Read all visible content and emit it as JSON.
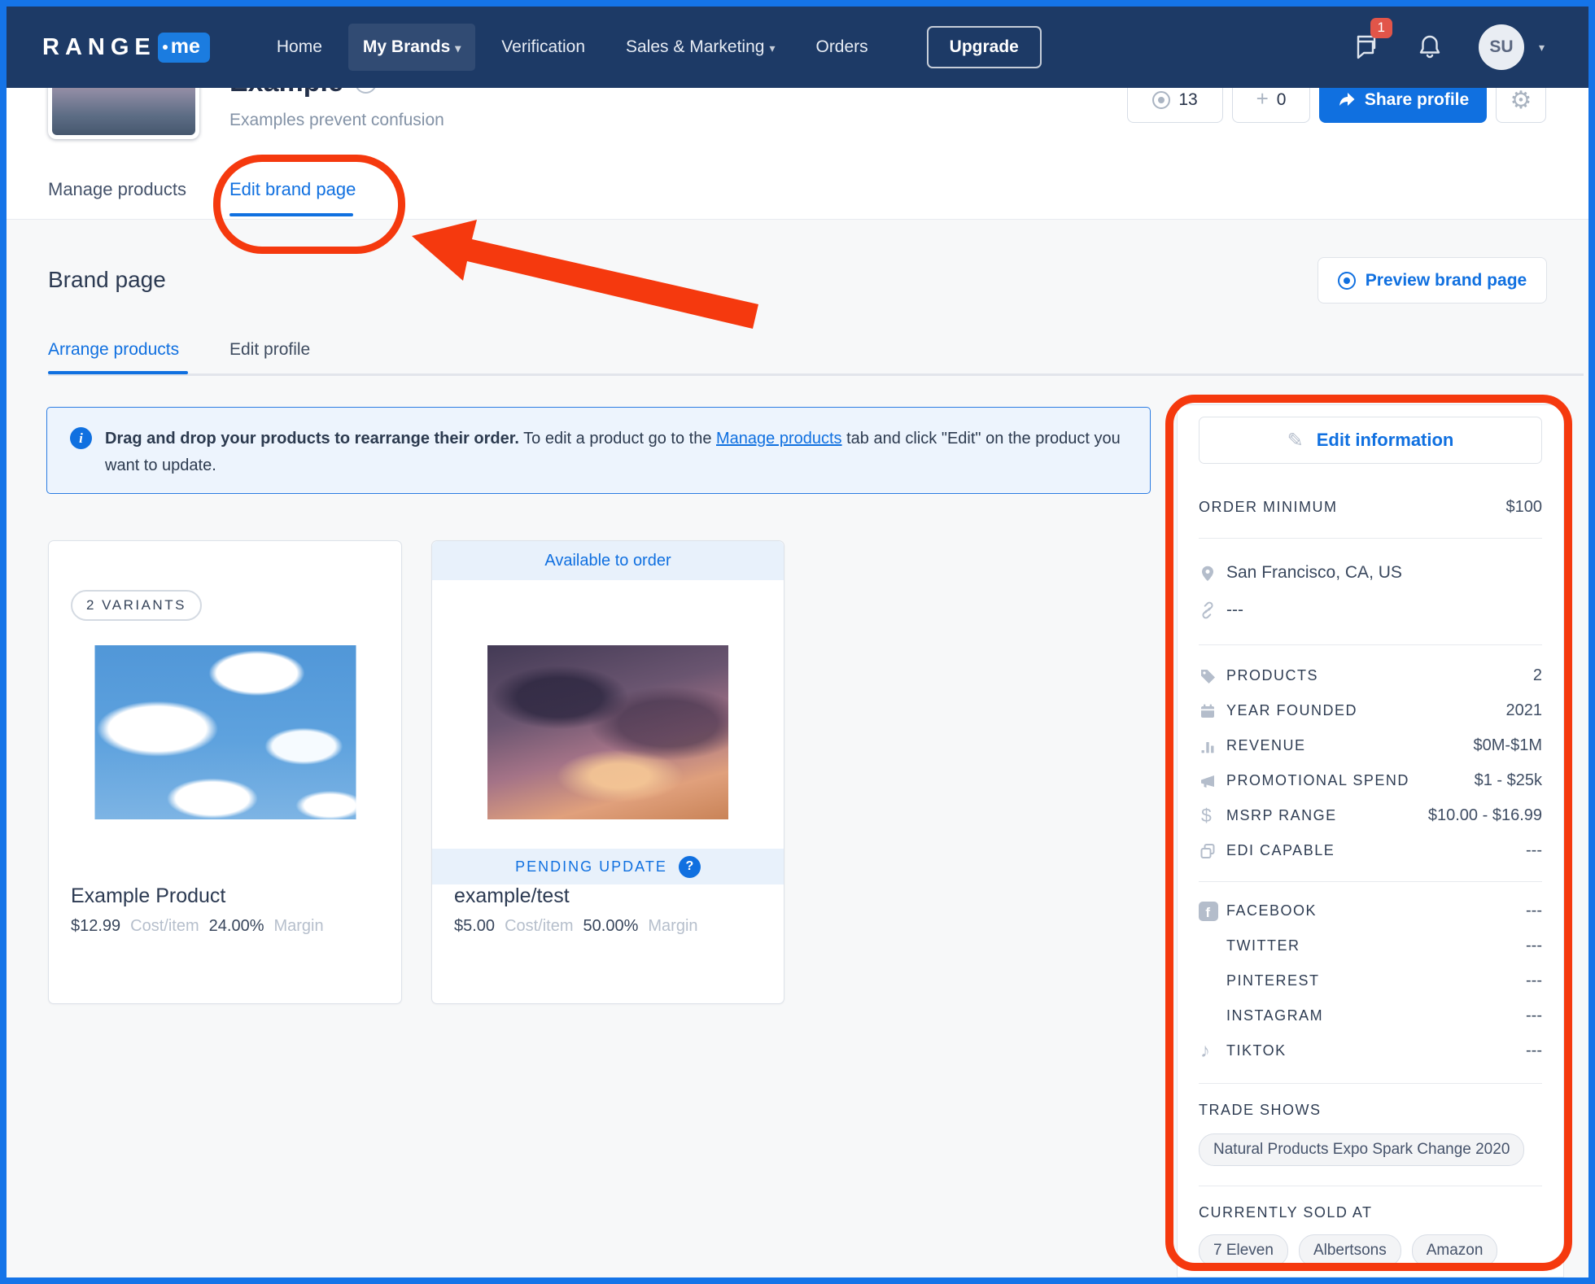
{
  "colors": {
    "accent": "#1070e0",
    "navbar": "#1d3a66",
    "annotation": "#f5390e",
    "page_border": "#1574e8"
  },
  "navbar": {
    "logo_range": "RANGE",
    "logo_me": "me",
    "items": [
      {
        "label": "Home"
      },
      {
        "label": "My Brands"
      },
      {
        "label": "Verification"
      },
      {
        "label": "Sales & Marketing"
      },
      {
        "label": "Orders"
      }
    ],
    "upgrade_label": "Upgrade",
    "chat_badge": "1",
    "avatar_initials": "SU"
  },
  "brand_header": {
    "title": "Example",
    "subtitle": "Examples prevent confusion",
    "views_count": "13",
    "follow_count": "0",
    "share_label": "Share profile"
  },
  "tabs": {
    "manage_products": "Manage products",
    "edit_brand_page": "Edit brand page"
  },
  "brand_page": {
    "title": "Brand page",
    "preview_label": "Preview brand page",
    "subtab_arrange": "Arrange products",
    "subtab_edit_profile": "Edit profile",
    "banner_bold": "Drag and drop your products to rearrange their order.",
    "banner_mid": " To edit a product go to the ",
    "banner_link": "Manage products",
    "banner_end": " tab and click \"Edit\" on the product you want to update."
  },
  "products": [
    {
      "badge": "2 VARIANTS",
      "name": "Example Product",
      "cost": "$12.99",
      "cost_label": "Cost/item",
      "margin": "24.00%",
      "margin_label": "Margin"
    },
    {
      "header": "Available to order",
      "status": "PENDING UPDATE",
      "name": "example/test",
      "cost": "$5.00",
      "cost_label": "Cost/item",
      "margin": "50.00%",
      "margin_label": "Margin"
    }
  ],
  "sidebar": {
    "edit_button": "Edit information",
    "order_minimum_label": "ORDER MINIMUM",
    "order_minimum_value": "$100",
    "location": "San Francisco, CA, US",
    "website": "---",
    "attributes": [
      {
        "label": "PRODUCTS",
        "value": "2"
      },
      {
        "label": "YEAR FOUNDED",
        "value": "2021"
      },
      {
        "label": "REVENUE",
        "value": "$0M-$1M"
      },
      {
        "label": "PROMOTIONAL SPEND",
        "value": "$1 - $25k"
      },
      {
        "label": "MSRP RANGE",
        "value": "$10.00 - $16.99"
      },
      {
        "label": "EDI CAPABLE",
        "value": "---"
      }
    ],
    "socials": [
      {
        "label": "FACEBOOK",
        "value": "---"
      },
      {
        "label": "TWITTER",
        "value": "---"
      },
      {
        "label": "PINTEREST",
        "value": "---"
      },
      {
        "label": "INSTAGRAM",
        "value": "---"
      },
      {
        "label": "TIKTOK",
        "value": "---"
      }
    ],
    "trade_shows_label": "TRADE SHOWS",
    "trade_shows": [
      "Natural Products Expo Spark Change 2020"
    ],
    "sold_at_label": "CURRENTLY SOLD AT",
    "sold_at": [
      "7 Eleven",
      "Albertsons",
      "Amazon"
    ]
  }
}
